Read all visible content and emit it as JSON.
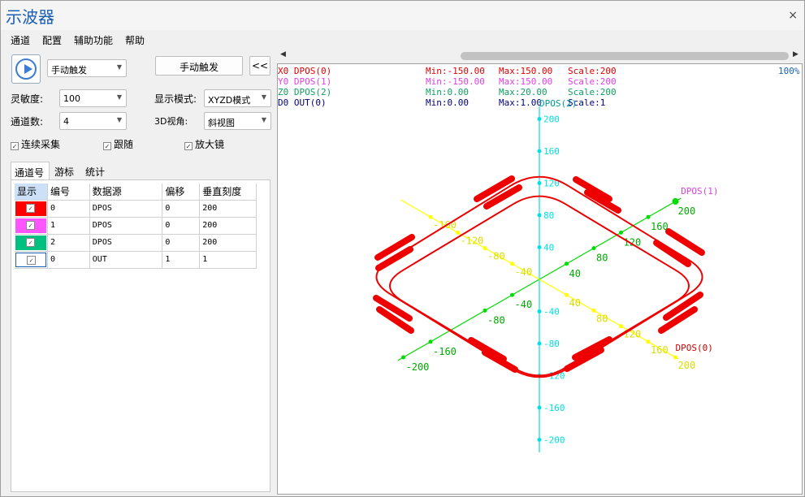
{
  "window": {
    "title": "示波器",
    "close_glyph": "×"
  },
  "menu": [
    "通道",
    "配置",
    "辅助功能",
    "帮助"
  ],
  "controls": {
    "trigger_mode": "手动触发",
    "trigger_button": "手动触发",
    "collapse_button": "<<",
    "sensitivity_label": "灵敏度:",
    "sensitivity_value": "100",
    "channels_label": "通道数:",
    "channels_value": "4",
    "display_mode_label": "显示模式:",
    "display_mode_value": "XYZD模式",
    "view3d_label": "3D视角:",
    "view3d_value": "斜视图",
    "continuous": "连续采集",
    "follow": "跟随",
    "magnifier": "放大镜"
  },
  "tabs": [
    "通道号",
    "游标",
    "统计"
  ],
  "table": {
    "headers": [
      "显示",
      "编号",
      "数据源",
      "偏移",
      "垂直刻度"
    ],
    "rows": [
      {
        "color": "#ff0000",
        "id": "0",
        "source": "DPOS",
        "offset": "0",
        "scale": "200"
      },
      {
        "color": "#ff55ff",
        "id": "1",
        "source": "DPOS",
        "offset": "0",
        "scale": "200"
      },
      {
        "color": "#00c080",
        "id": "2",
        "source": "DPOS",
        "offset": "0",
        "scale": "200"
      },
      {
        "color": "#ffffff",
        "id": "0",
        "source": "OUT",
        "offset": "1",
        "scale": "1"
      }
    ]
  },
  "scope": {
    "zoom": "100%",
    "info": [
      {
        "name": "X0 DPOS(0)",
        "min": "Min:-150.00",
        "max": "Max:150.00",
        "scale": "Scale:200",
        "color": "#e00000"
      },
      {
        "name": "Y0 DPOS(1)",
        "min": "Min:-150.00",
        "max": "Max:150.00",
        "scale": "Scale:200",
        "color": "#e040e0"
      },
      {
        "name": "Z0 DPOS(2)",
        "min": "Min:0.00",
        "max": "Max:20.00",
        "scale": "Scale:200",
        "color": "#10a060"
      },
      {
        "name": "D0 OUT(0)",
        "min": "Min:0.00",
        "max": "Max:1.00",
        "scale": "Scale:1",
        "color": "#000080"
      }
    ],
    "axis_labels": {
      "x": "DPOS(0)",
      "y": "DPOS(1)",
      "z": "DPOS(2)"
    },
    "z_ticks": [
      "200",
      "160",
      "120",
      "80",
      "40",
      "-40",
      "-80",
      "-120",
      "-160",
      "-200"
    ],
    "y_ticks": [
      "200",
      "160",
      "120",
      "80",
      "40",
      "-40",
      "-80",
      "-160",
      "-200"
    ],
    "x_ticks": [
      "-160",
      "-120",
      "-80",
      "-40",
      "40",
      "80",
      "120",
      "160",
      "200"
    ],
    "colors": {
      "x_axis": "#ffff00",
      "y_axis": "#00dd00",
      "z_axis": "#00e0e0",
      "path": "#ee0000"
    }
  }
}
